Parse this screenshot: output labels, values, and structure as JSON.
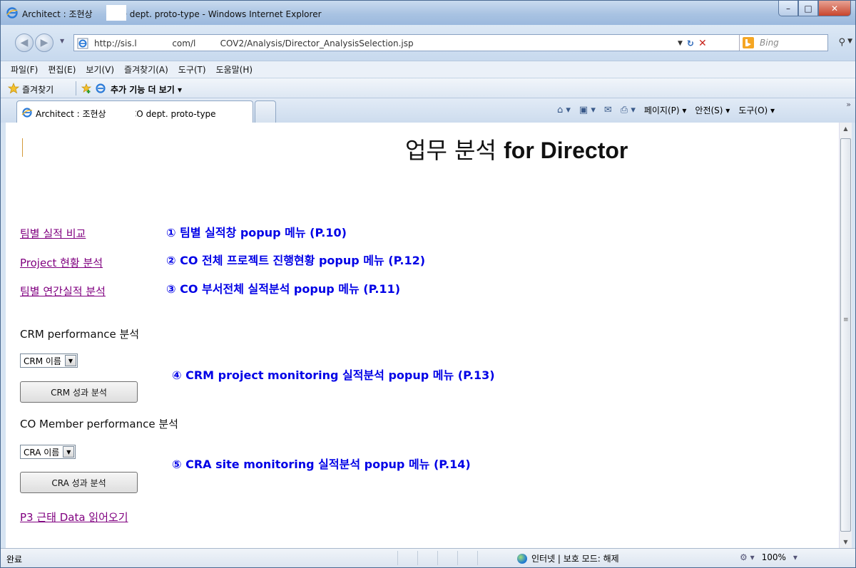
{
  "window": {
    "title": "Architect : 조현상        CO dept. proto-type - Windows Internet Explorer",
    "minimize": "–",
    "maximize": "□",
    "close": "✕"
  },
  "address_bar": {
    "url": "http://sis.l            .com/l         COV2/Analysis/Director_AnalysisSelection.jsp",
    "search_placeholder": "Bing"
  },
  "menu": [
    "파일(F)",
    "편집(E)",
    "보기(V)",
    "즐겨찾기(A)",
    "도구(T)",
    "도움말(H)"
  ],
  "favorites_bar": {
    "favorites_label": "즐겨찾기",
    "more_addons_label": "추가 기능 더 보기 ▾"
  },
  "tab": {
    "label": "Architect : 조현상         CO dept. proto-type"
  },
  "command_bar": {
    "page_label": "페이지(P) ▾",
    "safety_label": "안전(S) ▾",
    "tools_label": "도구(O) ▾"
  },
  "content": {
    "title_ko": "업무 분석",
    "title_en": "for Director",
    "links": [
      {
        "label": "팀별 실적 비교",
        "annotation": "① 팀별 실적창 popup 메뉴 (P.10)"
      },
      {
        "label": "Project 현황 분석",
        "annotation": "② CO 전체 프로젝트 진행현황 popup 메뉴 (P.12)"
      },
      {
        "label": "팀별 연간실적 분석",
        "annotation": "③ CO 부서전체 실적분석 popup 메뉴 (P.11)"
      }
    ],
    "crm": {
      "section_label": "CRM performance 분석",
      "select_value": "CRM 이름",
      "button_label": "CRM 성과 분석",
      "annotation": "④ CRM project monitoring 실적분석 popup 메뉴 (P.13)"
    },
    "cra": {
      "section_label": "CO Member performance 분석",
      "select_value": "CRA 이름",
      "button_label": "CRA 성과 분석",
      "annotation": "⑤ CRA site monitoring 실적분석 popup 메뉴 (P.14)"
    },
    "p3_link": "P3 근태 Data 읽어오기"
  },
  "status_bar": {
    "status": "완료",
    "zone": "인터넷 | 보호 모드: 해제",
    "zoom": "100%"
  },
  "icons": {
    "title": "ie-icon",
    "back": "back-arrow-icon",
    "forward": "forward-arrow-icon",
    "refresh": "refresh-icon",
    "stop": "stop-icon",
    "search": "search-icon",
    "favorites": "star-icon",
    "home": "home-icon",
    "feeds": "rss-icon",
    "mail": "mail-icon",
    "print": "print-icon"
  },
  "colors": {
    "link_visited": "#800080",
    "annotation": "#0000e6",
    "close_button": "#c8452d"
  }
}
